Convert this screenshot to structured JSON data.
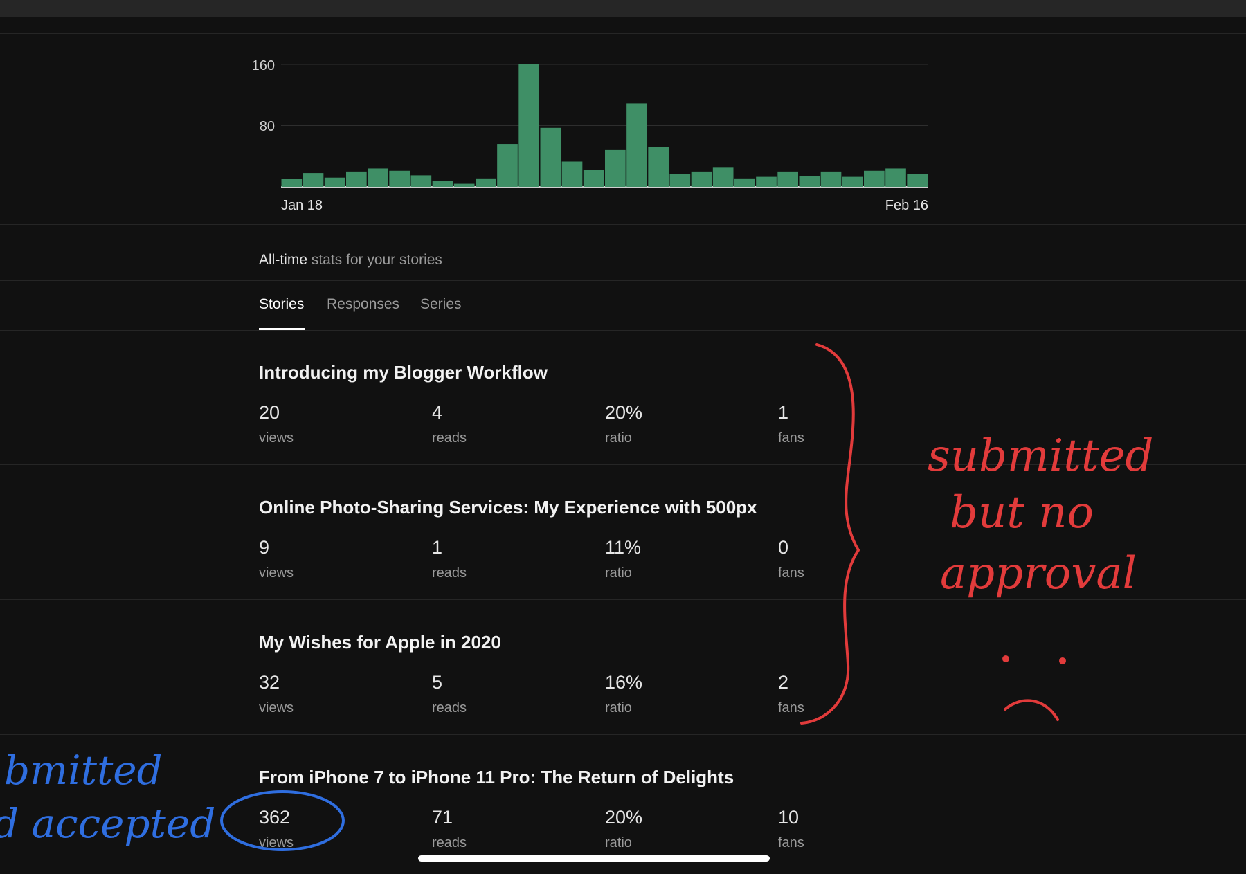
{
  "chart_data": {
    "type": "bar",
    "y_ticks": [
      "160",
      "80"
    ],
    "ylim": [
      0,
      160
    ],
    "x_start_label": "Jan 18",
    "x_end_label": "Feb 16",
    "values": [
      10,
      18,
      12,
      20,
      24,
      21,
      15,
      8,
      4,
      11,
      56,
      160,
      77,
      33,
      22,
      48,
      109,
      52,
      17,
      20,
      25,
      11,
      13,
      20,
      14,
      20,
      13,
      21,
      24,
      17
    ],
    "bar_color": "#3f8f66",
    "grid": true
  },
  "stats_heading": {
    "highlight": "All-time",
    "rest": " stats for your stories"
  },
  "tabs": [
    {
      "label": "Stories",
      "active": true
    },
    {
      "label": "Responses",
      "active": false
    },
    {
      "label": "Series",
      "active": false
    }
  ],
  "stories": [
    {
      "title": "Introducing my Blogger Workflow",
      "views": "20",
      "reads": "4",
      "ratio": "20%",
      "fans": "1"
    },
    {
      "title": "Online Photo-Sharing Services: My Experience with 500px",
      "views": "9",
      "reads": "1",
      "ratio": "11%",
      "fans": "0"
    },
    {
      "title": "My Wishes for Apple in 2020",
      "views": "32",
      "reads": "5",
      "ratio": "16%",
      "fans": "2"
    },
    {
      "title": "From iPhone 7 to iPhone 11 Pro: The Return of Delights",
      "views": "362",
      "reads": "71",
      "ratio": "20%",
      "fans": "10"
    }
  ],
  "metric_labels": {
    "views": "views",
    "reads": "reads",
    "ratio": "ratio",
    "fans": "fans"
  },
  "annotations": {
    "red_note": [
      "submitted",
      "but no",
      "approval"
    ],
    "blue_note": [
      "bmitted",
      "d accepted"
    ],
    "red_color": "#e23b3b",
    "blue_color": "#2f6ee0"
  }
}
